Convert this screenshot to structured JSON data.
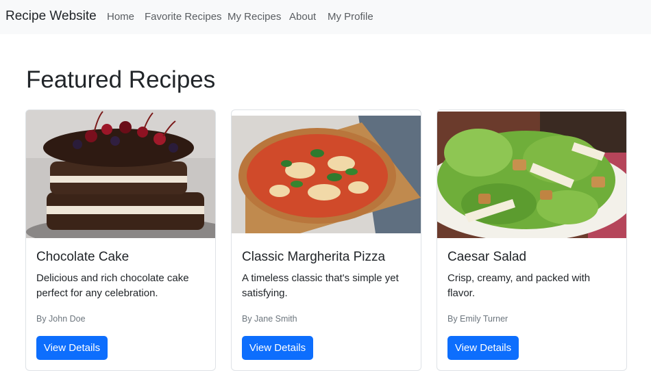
{
  "navbar": {
    "brand": "Recipe Website",
    "links": [
      "Home",
      "Favorite Recipes",
      "My Recipes",
      "About",
      "My Profile"
    ]
  },
  "main": {
    "title": "Featured Recipes",
    "cards": [
      {
        "title": "Chocolate Cake",
        "description": "Delicious and rich chocolate cake perfect for any celebration.",
        "author": "By John Doe",
        "button": "View Details"
      },
      {
        "title": "Classic Margherita Pizza",
        "description": "A timeless classic that's simple yet satisfying.",
        "author": "By Jane Smith",
        "button": "View Details"
      },
      {
        "title": "Caesar Salad",
        "description": "Crisp, creamy, and packed with flavor.",
        "author": "By Emily Turner",
        "button": "View Details"
      }
    ]
  },
  "colors": {
    "navbar_bg": "#f8f9fa",
    "button_primary": "#0d6efd",
    "text_muted": "#6c757d"
  }
}
